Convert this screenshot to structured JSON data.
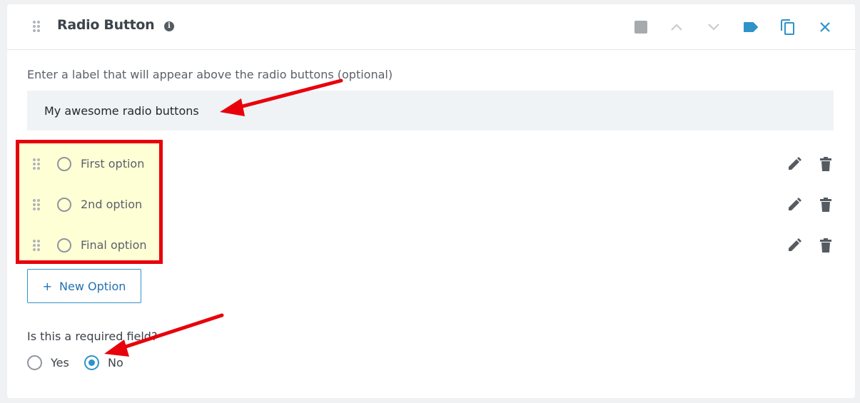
{
  "header": {
    "title": "Radio Button",
    "info_icon": "info-icon",
    "actions": [
      {
        "name": "block-square-icon",
        "label": ""
      },
      {
        "name": "move-up-icon",
        "label": ""
      },
      {
        "name": "move-down-icon",
        "label": ""
      },
      {
        "name": "tag-icon",
        "label": ""
      },
      {
        "name": "duplicate-icon",
        "label": ""
      },
      {
        "name": "close-icon",
        "label": ""
      }
    ]
  },
  "field": {
    "label_hint": "Enter a label that will appear above the radio buttons (optional)",
    "label_value": "My awesome radio buttons"
  },
  "options": [
    {
      "label": "First option"
    },
    {
      "label": "2nd option"
    },
    {
      "label": "Final option"
    }
  ],
  "new_option_button": {
    "icon": "+",
    "label": "New Option"
  },
  "required": {
    "question": "Is this a required field?",
    "choices": [
      {
        "label": "Yes",
        "checked": false
      },
      {
        "label": "No",
        "checked": true
      }
    ]
  },
  "colors": {
    "accent": "#2f93c9",
    "annotation_red": "#e8000b",
    "highlight": "#ffffd6"
  }
}
